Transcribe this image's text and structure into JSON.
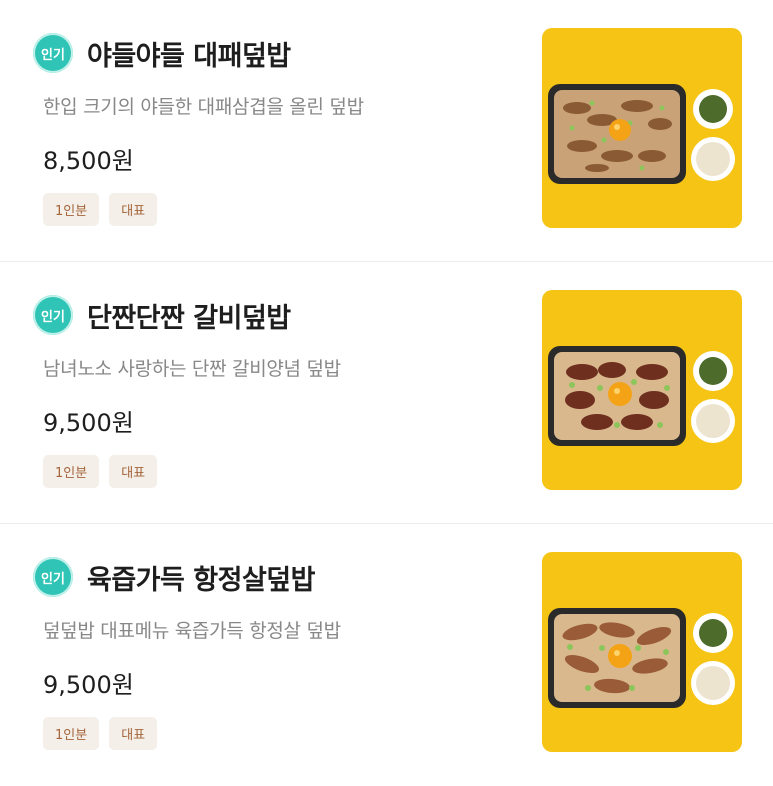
{
  "menu_items": [
    {
      "badge": "인기",
      "name": "야들야들 대패덮밥",
      "description": "한입 크기의 야들한 대패삼겹을 올린 덮밥",
      "price": "8,500원",
      "tags": [
        "1인분",
        "대표"
      ],
      "image_icon": "bowl-of-sliced-pork-on-rice-with-egg-yolk"
    },
    {
      "badge": "인기",
      "name": "단짠단짠 갈비덮밥",
      "description": "남녀노소 사랑하는 단짠 갈비양념 덮밥",
      "price": "9,500원",
      "tags": [
        "1인분",
        "대표"
      ],
      "image_icon": "bowl-of-galbi-on-rice-with-egg-yolk"
    },
    {
      "badge": "인기",
      "name": "육즙가득 항정살덮밥",
      "description": "덮덮밥 대표메뉴 육즙가득 항정살 덮밥",
      "price": "9,500원",
      "tags": [
        "1인분",
        "대표"
      ],
      "image_icon": "bowl-of-pork-jowl-on-rice-with-egg-yolk"
    }
  ],
  "colors": {
    "badge": "#2fc4b6",
    "tag_background": "#f4efe8",
    "tag_text": "#a4643a",
    "image_background": "#f5c414"
  }
}
